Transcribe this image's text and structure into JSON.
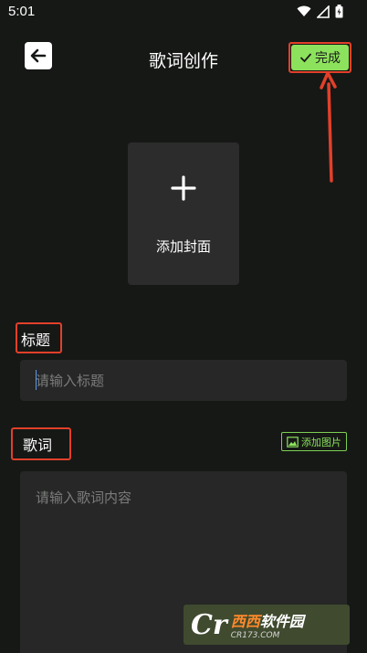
{
  "status_bar": {
    "time": "5:01",
    "icons": [
      "wifi-icon",
      "signal-icon",
      "battery-icon"
    ]
  },
  "header": {
    "title": "歌词创作",
    "done_label": "完成",
    "back_icon": "arrow-left-icon"
  },
  "cover": {
    "label": "添加封面",
    "icon": "plus-icon"
  },
  "title_section": {
    "label": "标题",
    "placeholder": "请输入标题"
  },
  "lyrics_section": {
    "label": "歌词",
    "add_image_label": "添加图片",
    "placeholder": "请输入歌词内容"
  },
  "watermark": {
    "logo": "Cr",
    "name_highlight": "西西",
    "name_rest": "软件园",
    "url": "CR173.COM"
  },
  "colors": {
    "accent": "#8ce25c",
    "annotation": "#e2402a",
    "background": "#161816",
    "field": "#262726"
  }
}
